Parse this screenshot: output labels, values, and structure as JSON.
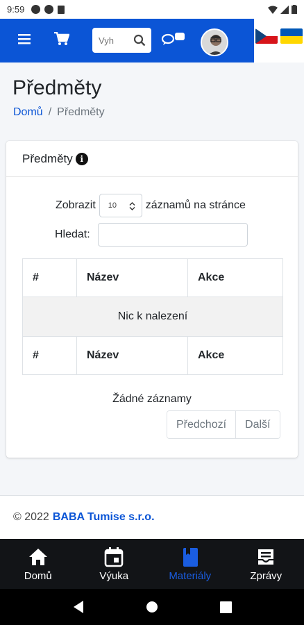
{
  "status_bar": {
    "time": "9:59"
  },
  "header": {
    "search_placeholder": "Vyh",
    "menu_icon": "hamburger-icon",
    "cart_icon": "cart-icon",
    "chat_icon": "chat-icon",
    "flags": [
      "czech-flag",
      "ukraine-flag"
    ]
  },
  "page": {
    "title": "Předměty",
    "breadcrumb": {
      "home": "Domů",
      "separator": "/",
      "current": "Předměty"
    }
  },
  "card": {
    "title": "Předměty",
    "show_prefix": "Zobrazit",
    "show_value": "10",
    "show_suffix": "záznamů na stránce",
    "search_label": "Hledat:",
    "table": {
      "columns": [
        "#",
        "Název",
        "Akce"
      ],
      "empty_text": "Nic k nalezení"
    },
    "info_text": "Žádné záznamy",
    "pager": {
      "prev": "Předchozí",
      "next": "Další"
    }
  },
  "footer": {
    "copyright": "© 2022",
    "company": "BABA Tumise s.r.o."
  },
  "bottom_nav": [
    {
      "label": "Domů",
      "icon": "home-icon",
      "active": false
    },
    {
      "label": "Výuka",
      "icon": "calendar-icon",
      "active": false
    },
    {
      "label": "Materiály",
      "icon": "book-icon",
      "active": true
    },
    {
      "label": "Zprávy",
      "icon": "inbox-icon",
      "active": false
    }
  ],
  "colors": {
    "primary": "#0b55d6",
    "active_tab": "#1a5de0",
    "bottom_nav_bg": "#121417"
  }
}
